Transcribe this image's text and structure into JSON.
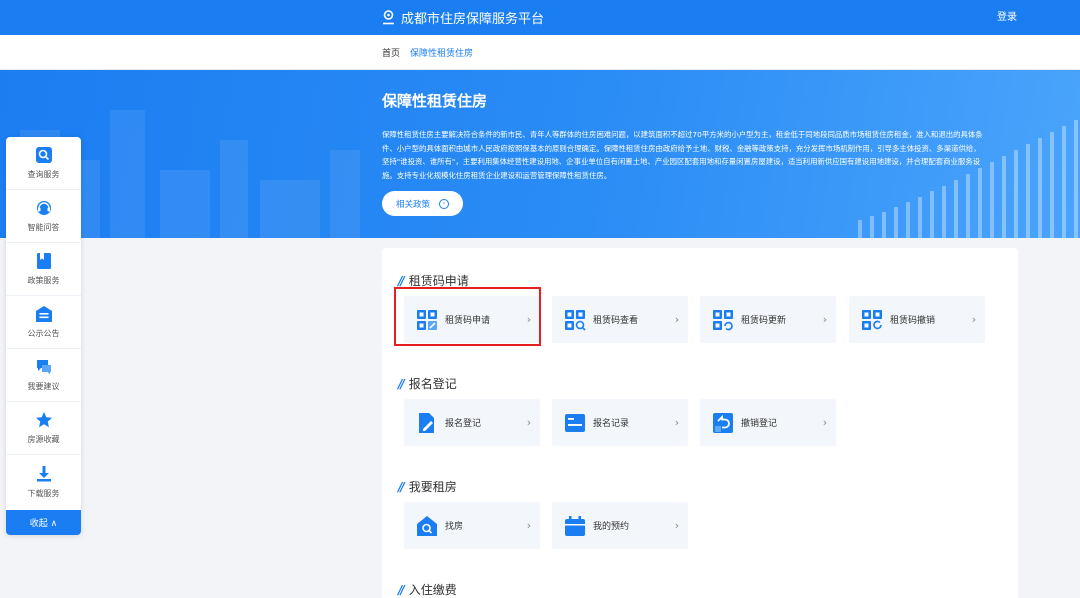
{
  "header": {
    "title": "成都市住房保障服务平台",
    "login_label": "登录"
  },
  "breadcrumb": {
    "home": "首页",
    "current": "保障性租赁住房"
  },
  "banner": {
    "title": "保障性租赁住房",
    "description": "保障性租赁住房主要解决符合条件的新市民、青年人等群体的住房困难问题，以建筑面积不超过70平方米的小户型为主，租金低于同地段同品质市场租赁住房租金，准入和退出的具体条件、小户型的具体面积由城市人民政府按照保基本的原则合理确定。保障性租赁住房由政府给予土地、财税、金融等政策支持，充分发挥市场机制作用，引导多主体投资、多渠道供给，坚持\"谁投资、谁所有\"，主要利用集体经营性建设用地、企事业单位自有闲置土地、产业园区配套用地和存量闲置房屋建设，适当利用新供应国有建设用地建设，并合理配套商业服务设施。支持专业化规模化住房租赁企业建设和运营管理保障性租赁住房。",
    "policy_button": "相关政策"
  },
  "sidebar": {
    "items": [
      {
        "label": "查询服务",
        "icon": "search-icon"
      },
      {
        "label": "智能问答",
        "icon": "support-icon"
      },
      {
        "label": "政策服务",
        "icon": "book-icon"
      },
      {
        "label": "公示公告",
        "icon": "notice-icon"
      },
      {
        "label": "我要建议",
        "icon": "chat-icon"
      },
      {
        "label": "房源收藏",
        "icon": "star-icon"
      },
      {
        "label": "下载服务",
        "icon": "download-icon"
      }
    ],
    "collapse_label": "收起 ∧"
  },
  "sections": [
    {
      "title": "租赁码申请",
      "cards": [
        {
          "label": "租赁码申请"
        },
        {
          "label": "租赁码查看"
        },
        {
          "label": "租赁码更新"
        },
        {
          "label": "租赁码撤销"
        }
      ]
    },
    {
      "title": "报名登记",
      "cards": [
        {
          "label": "报名登记"
        },
        {
          "label": "报名记录"
        },
        {
          "label": "撤销登记"
        }
      ]
    },
    {
      "title": "我要租房",
      "cards": [
        {
          "label": "找房"
        },
        {
          "label": "我的预约"
        }
      ]
    },
    {
      "title": "入住缴费",
      "cards": []
    }
  ],
  "colors": {
    "primary": "#1a7ef2",
    "highlight": "#e51e1e"
  }
}
